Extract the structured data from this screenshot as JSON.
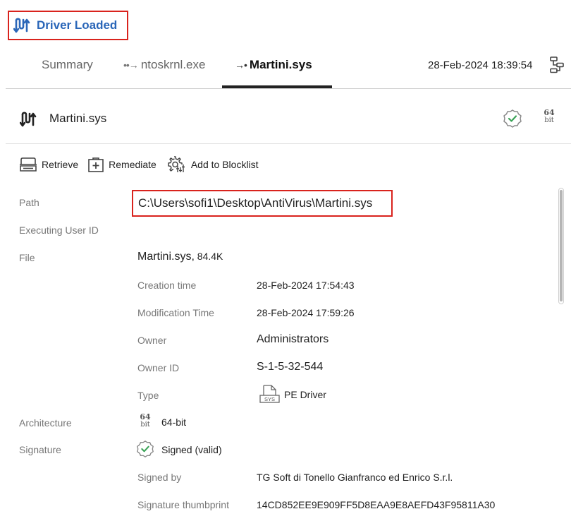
{
  "header": {
    "title": "Driver Loaded",
    "icon": "driver-arrows-icon"
  },
  "tabs": [
    {
      "label": "Summary",
      "active": false
    },
    {
      "label": "ntoskrnl.exe",
      "prefix": "••→",
      "active": false
    },
    {
      "label": "Martini.sys",
      "prefix": "→•",
      "active": true
    }
  ],
  "timestamp": "28-Feb-2024 18:39:54",
  "process": {
    "name": "Martini.sys",
    "bitness_number": "64",
    "bitness_unit": "bit"
  },
  "actions": {
    "retrieve": "Retrieve",
    "remediate": "Remediate",
    "blocklist": "Add to Blocklist"
  },
  "details": {
    "path_label": "Path",
    "path_value": "C:\\Users\\sofi1\\Desktop\\AntiVirus\\Martini.sys",
    "executing_user_label": "Executing User ID",
    "file_label": "File",
    "file_name": "Martini.sys,",
    "file_size": "84.4K",
    "creation_label": "Creation time",
    "creation_value": "28-Feb-2024 17:54:43",
    "modification_label": "Modification Time",
    "modification_value": "28-Feb-2024 17:59:26",
    "owner_label": "Owner",
    "owner_value": "Administrators",
    "owner_id_label": "Owner ID",
    "owner_id_value": "S-1-5-32-544",
    "type_label": "Type",
    "type_value": "PE Driver",
    "type_icon_text": "SYS",
    "architecture_label": "Architecture",
    "architecture_badge_number": "64",
    "architecture_badge_unit": "bit",
    "architecture_value": "64-bit",
    "signature_label": "Signature",
    "signature_value": "Signed (valid)",
    "signed_by_label": "Signed by",
    "signed_by_value": "TG Soft di Tonello Gianfranco ed Enrico S.r.l.",
    "thumbprint_label": "Signature thumbprint",
    "thumbprint_value": "14CD852EE9E909FF5D8EAA9E8AEFD43F95811A30"
  },
  "colors": {
    "accent": "#2a66b8",
    "highlight": "#d9231d",
    "valid": "#3aa357"
  }
}
